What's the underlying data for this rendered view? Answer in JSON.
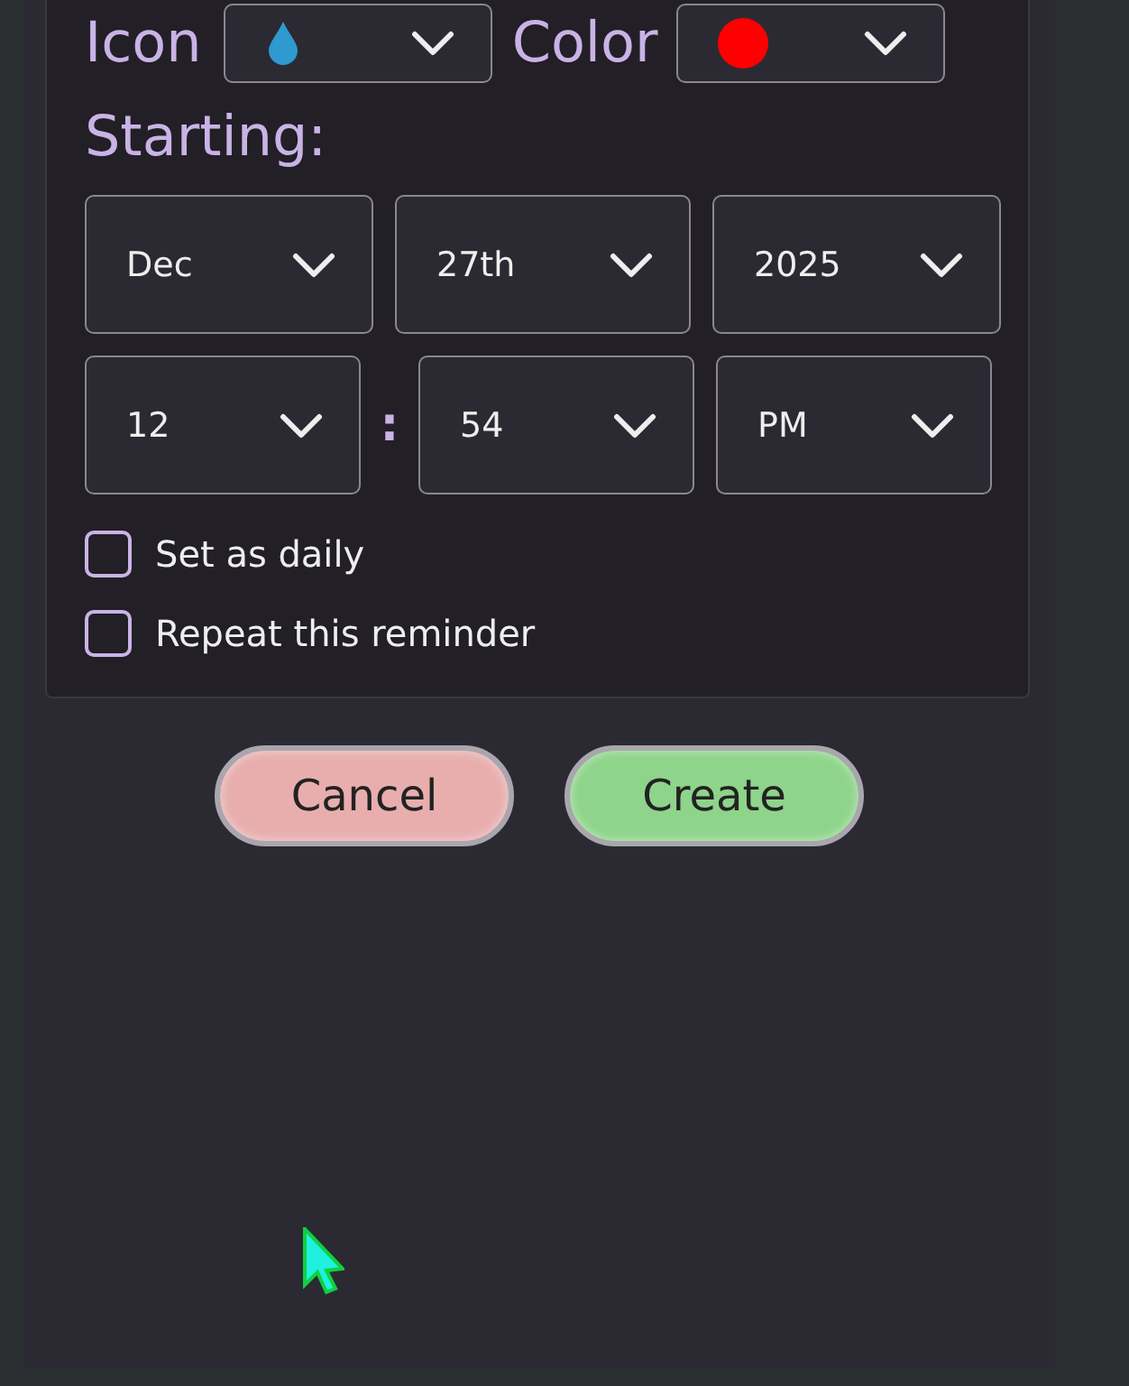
{
  "icon_picker": {
    "label": "Icon"
  },
  "color_picker": {
    "label": "Color",
    "color": "#ff0000"
  },
  "starting": {
    "label": "Starting:",
    "date": [
      {
        "value": "Dec"
      },
      {
        "value": "27th"
      },
      {
        "value": "2025"
      }
    ],
    "time": [
      {
        "value": "12"
      },
      {
        "value": "54"
      },
      {
        "value": "PM"
      }
    ],
    "separator": ":"
  },
  "options": [
    {
      "label": "Set as daily",
      "checked": false
    },
    {
      "label": "Repeat this reminder",
      "checked": false
    }
  ],
  "buttons": [
    {
      "label": "Cancel",
      "kind": "cancel"
    },
    {
      "label": "Create",
      "kind": "create"
    }
  ]
}
